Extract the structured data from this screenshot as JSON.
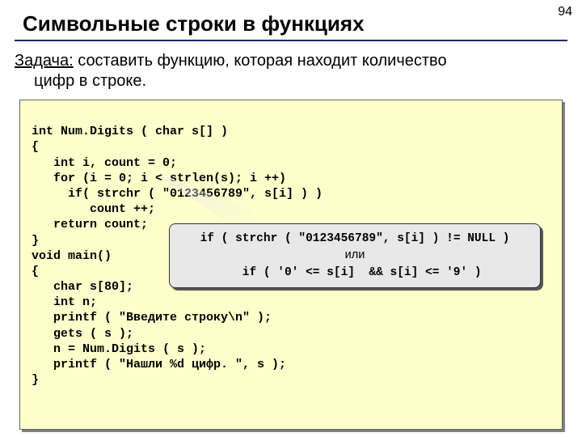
{
  "page_number": "94",
  "title": "Символьные строки в функциях",
  "task": {
    "label": "Задача:",
    "line1": " составить функцию, которая находит количество",
    "line2": "цифр в строке."
  },
  "code": {
    "l01": "int Num.Digits ( char s[] )",
    "l02": "{",
    "l03": "   int i, count = 0;",
    "l04": "   for (i = 0; i < strlen(s); i ++)",
    "l05": "     if( strchr ( \"0123456789\", s[i] ) )",
    "l06": "        count ++;",
    "l07": "   return count;",
    "l08": "}",
    "l09": "void main()",
    "l10": "{",
    "l11": "   char s[80];",
    "l12": "   int n;",
    "l13": "   printf ( \"Введите строку\\n\" );",
    "l14": "   gets ( s );",
    "l15": "   n = Num.Digits ( s );",
    "l16": "   printf ( \"Нашли %d цифр. \", s );",
    "l17": "}"
  },
  "callout": {
    "line1": "if ( strchr ( \"0123456789\", s[i] ) != NULL )",
    "or": "или",
    "line2": "  if ( '0' <= s[i]  && s[i] <= '9' )"
  }
}
